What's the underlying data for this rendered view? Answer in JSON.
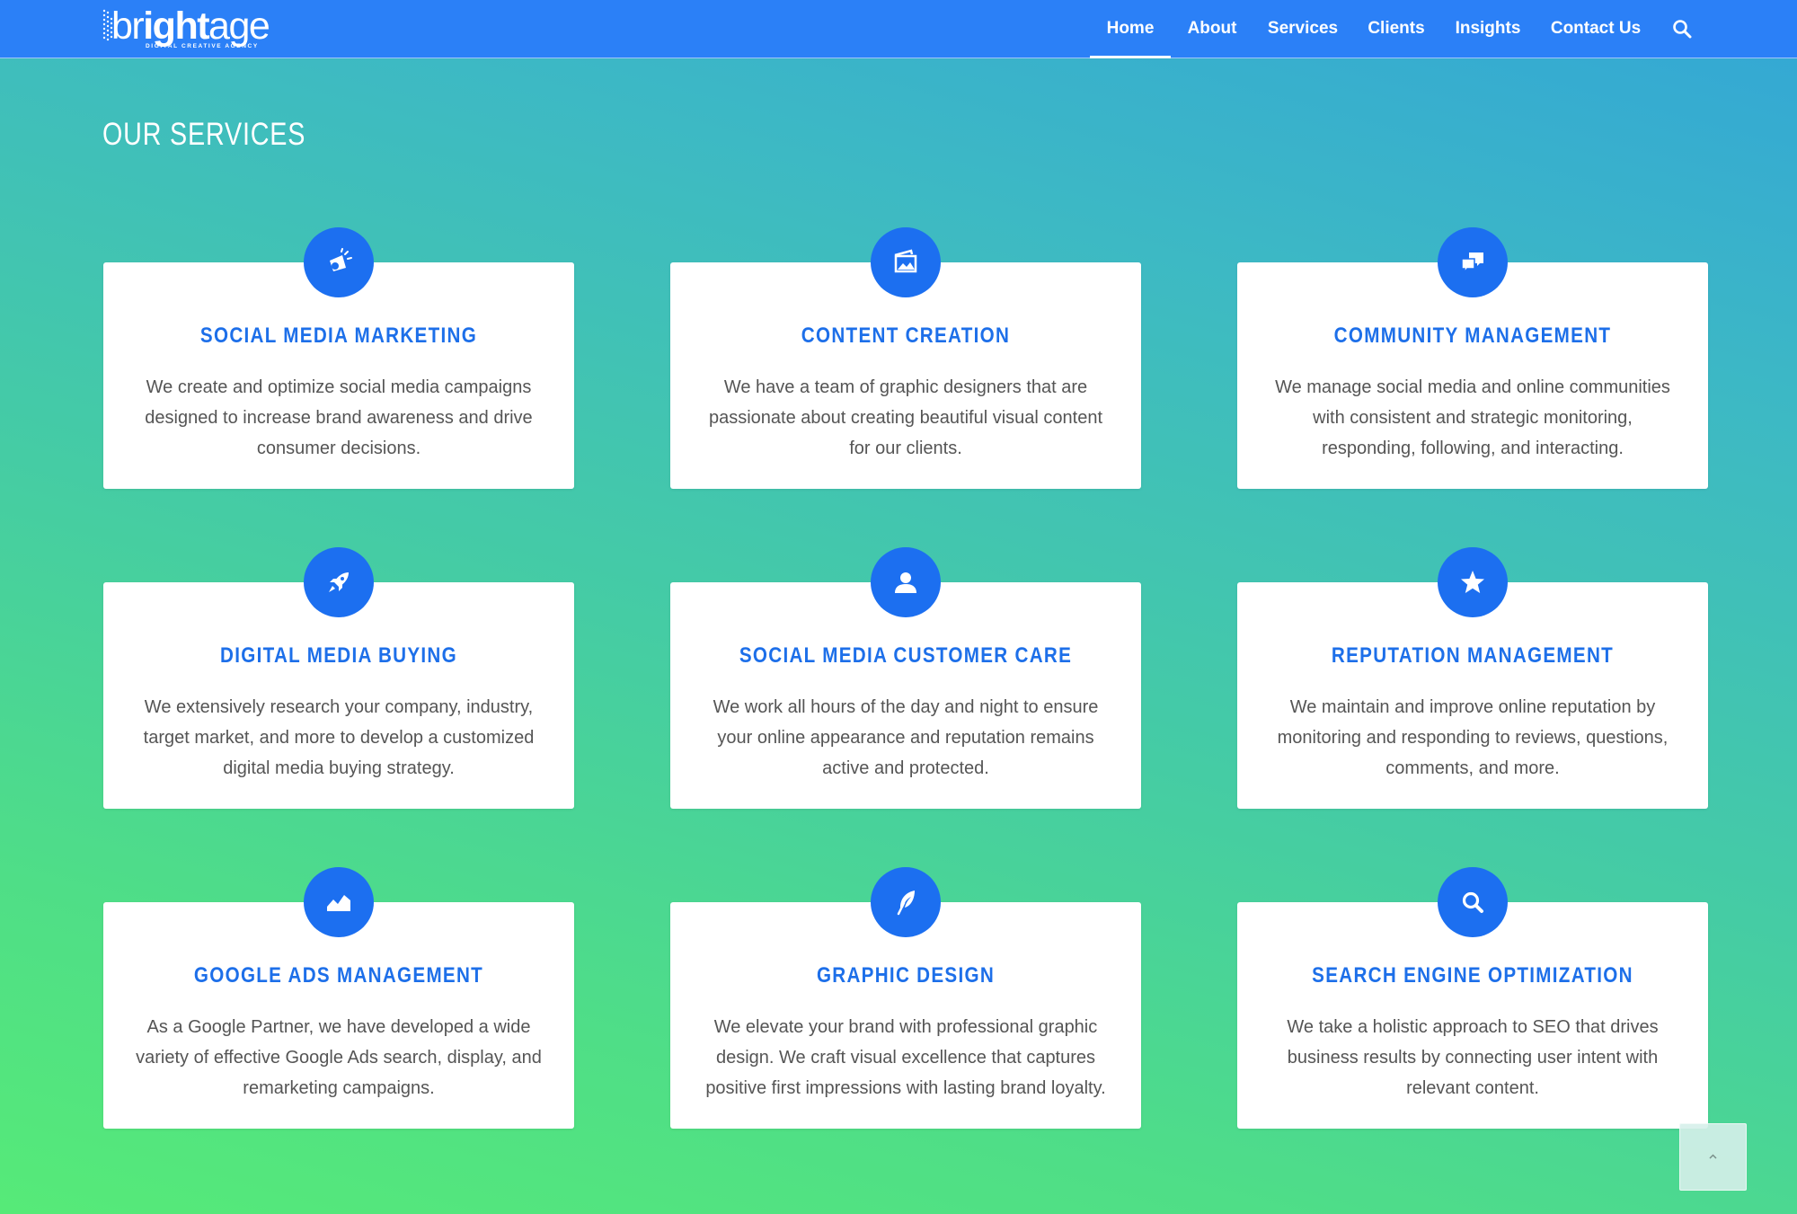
{
  "brand": {
    "name_light1": "br",
    "name_bold": "ight",
    "name_light2": "age",
    "tagline": "DIGITAL CREATIVE AGENCY"
  },
  "nav": {
    "items": [
      {
        "label": "Home",
        "active": true
      },
      {
        "label": "About",
        "active": false
      },
      {
        "label": "Services",
        "active": false
      },
      {
        "label": "Clients",
        "active": false
      },
      {
        "label": "Insights",
        "active": false
      },
      {
        "label": "Contact Us",
        "active": false
      }
    ],
    "search_icon": "search-icon"
  },
  "section_title": "OUR SERVICES",
  "services": [
    {
      "icon": "megaphone-icon",
      "title": "SOCIAL MEDIA MARKETING",
      "text": "We create and optimize social media campaigns designed to increase brand awareness and drive consumer decisions."
    },
    {
      "icon": "image-icon",
      "title": "CONTENT CREATION",
      "text": "We have a team of graphic designers that are passionate about creating beautiful visual content for our clients."
    },
    {
      "icon": "chat-bubbles-icon",
      "title": "COMMUNITY MANAGEMENT",
      "text": "We manage social media and online communities with consistent and strategic monitoring, responding, following, and interacting."
    },
    {
      "icon": "rocket-icon",
      "title": "DIGITAL MEDIA BUYING",
      "text": "We extensively research your company, industry, target market, and more to develop a customized digital media buying strategy."
    },
    {
      "icon": "user-icon",
      "title": "SOCIAL MEDIA CUSTOMER CARE",
      "text": "We work all hours of the day and night to ensure your online appearance and reputation remains active and protected."
    },
    {
      "icon": "star-icon",
      "title": "REPUTATION MANAGEMENT",
      "text": "We maintain and improve online reputation by monitoring and responding to reviews, questions, comments, and more."
    },
    {
      "icon": "area-chart-icon",
      "title": "GOOGLE ADS MANAGEMENT",
      "text": "As a Google Partner, we have developed a wide variety of effective Google Ads search, display, and remarketing campaigns."
    },
    {
      "icon": "feather-icon",
      "title": "GRAPHIC DESIGN",
      "text": "We elevate your brand with professional graphic design. We craft visual excellence that captures positive first impressions with lasting brand loyalty."
    },
    {
      "icon": "search-icon",
      "title": "SEARCH ENGINE OPTIMIZATION",
      "text": "We take a holistic approach to SEO that drives business results by connecting user intent with relevant content."
    }
  ],
  "scroll_top_icon": "chevron-up-icon",
  "colors": {
    "header": "#2b80f7",
    "accent": "#1c6ff0",
    "title": "#1d6fe9",
    "body_text": "#555555"
  }
}
